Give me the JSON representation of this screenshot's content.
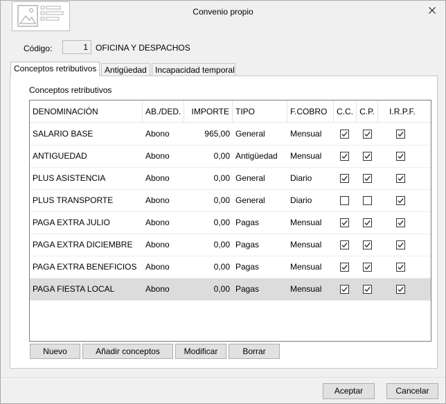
{
  "window": {
    "title": "Convenio propio"
  },
  "code": {
    "label": "Código:",
    "value": "1",
    "name": "OFICINA Y DESPACHOS"
  },
  "tabs": [
    {
      "label": "Conceptos retributivos",
      "active": true
    },
    {
      "label": "Antigüedad",
      "active": false
    },
    {
      "label": "Incapacidad temporal",
      "active": false
    }
  ],
  "panel": {
    "group_label": "Conceptos retributivos"
  },
  "columns": [
    "DENOMINACIÓN",
    "AB./DED.",
    "IMPORTE",
    "TIPO",
    "F.COBRO",
    "C.C.",
    "C.P.",
    "I.R.P.F."
  ],
  "rows": [
    {
      "denominacion": "SALARIO BASE",
      "abded": "Abono",
      "importe": "965,00",
      "tipo": "General",
      "fcobro": "Mensual",
      "cc": true,
      "cp": true,
      "irpf": true
    },
    {
      "denominacion": "ANTIGUEDAD",
      "abded": "Abono",
      "importe": "0,00",
      "tipo": "Antigüedad",
      "fcobro": "Mensual",
      "cc": true,
      "cp": true,
      "irpf": true
    },
    {
      "denominacion": "PLUS ASISTENCIA",
      "abded": "Abono",
      "importe": "0,00",
      "tipo": "General",
      "fcobro": "Diario",
      "cc": true,
      "cp": true,
      "irpf": true
    },
    {
      "denominacion": "PLUS TRANSPORTE",
      "abded": "Abono",
      "importe": "0,00",
      "tipo": "General",
      "fcobro": "Diario",
      "cc": false,
      "cp": false,
      "irpf": true
    },
    {
      "denominacion": "PAGA EXTRA JULIO",
      "abded": "Abono",
      "importe": "0,00",
      "tipo": "Pagas",
      "fcobro": "Mensual",
      "cc": true,
      "cp": true,
      "irpf": true
    },
    {
      "denominacion": "PAGA EXTRA DICIEMBRE",
      "abded": "Abono",
      "importe": "0,00",
      "tipo": "Pagas",
      "fcobro": "Mensual",
      "cc": true,
      "cp": true,
      "irpf": true
    },
    {
      "denominacion": "PAGA EXTRA BENEFICIOS",
      "abded": "Abono",
      "importe": "0,00",
      "tipo": "Pagas",
      "fcobro": "Mensual",
      "cc": true,
      "cp": true,
      "irpf": true
    },
    {
      "denominacion": "PAGA FIESTA LOCAL",
      "abded": "Abono",
      "importe": "0,00",
      "tipo": "Pagas",
      "fcobro": "Mensual",
      "cc": true,
      "cp": true,
      "irpf": true,
      "selected": true
    }
  ],
  "actions": {
    "nuevo": "Nuevo",
    "anadir": "Añadir conceptos",
    "modificar": "Modificar",
    "borrar": "Borrar"
  },
  "footer": {
    "aceptar": "Aceptar",
    "cancelar": "Cancelar"
  }
}
